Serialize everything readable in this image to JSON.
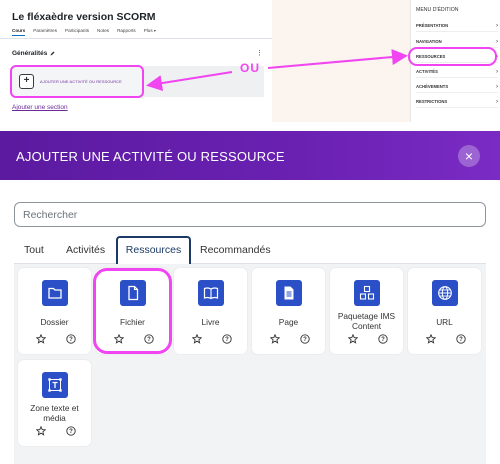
{
  "course": {
    "title": "Le fléxaèdre version SCORM",
    "nav": [
      "Cours",
      "Paramètres",
      "Participants",
      "Notes",
      "Rapports",
      "Plus"
    ],
    "section_title": "Généralités",
    "add_activity_label": "AJOUTER UNE ACTIVITÉ OU RESSOURCE",
    "add_section_label": "Ajouter une section"
  },
  "annotation": {
    "ou": "OU"
  },
  "edit_menu": {
    "title": "MENU D'ÉDITION",
    "items": [
      "PRÉSENTATION",
      "NAVIGATION",
      "RESSOURCES",
      "ACTIVITÉS",
      "ACHÈVEMENTS",
      "RESTRICTIONS"
    ]
  },
  "modal": {
    "title": "AJOUTER UNE ACTIVITÉ OU RESSOURCE",
    "close": "×",
    "search_placeholder": "Rechercher",
    "tabs": [
      "Tout",
      "Activités",
      "Ressources",
      "Recommandés"
    ],
    "active_tab": "Ressources",
    "cards": [
      {
        "label": "Dossier",
        "icon": "folder-icon"
      },
      {
        "label": "Fichier",
        "icon": "file-icon"
      },
      {
        "label": "Livre",
        "icon": "book-icon"
      },
      {
        "label": "Page",
        "icon": "page-icon"
      },
      {
        "label": "Paquetage IMS Content",
        "icon": "ims-package-icon"
      },
      {
        "label": "URL",
        "icon": "globe-icon"
      },
      {
        "label": "Zone texte et média",
        "icon": "text-media-icon"
      }
    ]
  },
  "colors": {
    "accent": "#5b1aa0",
    "highlight": "#f045f0",
    "icon_bg": "#2b4fc7"
  }
}
